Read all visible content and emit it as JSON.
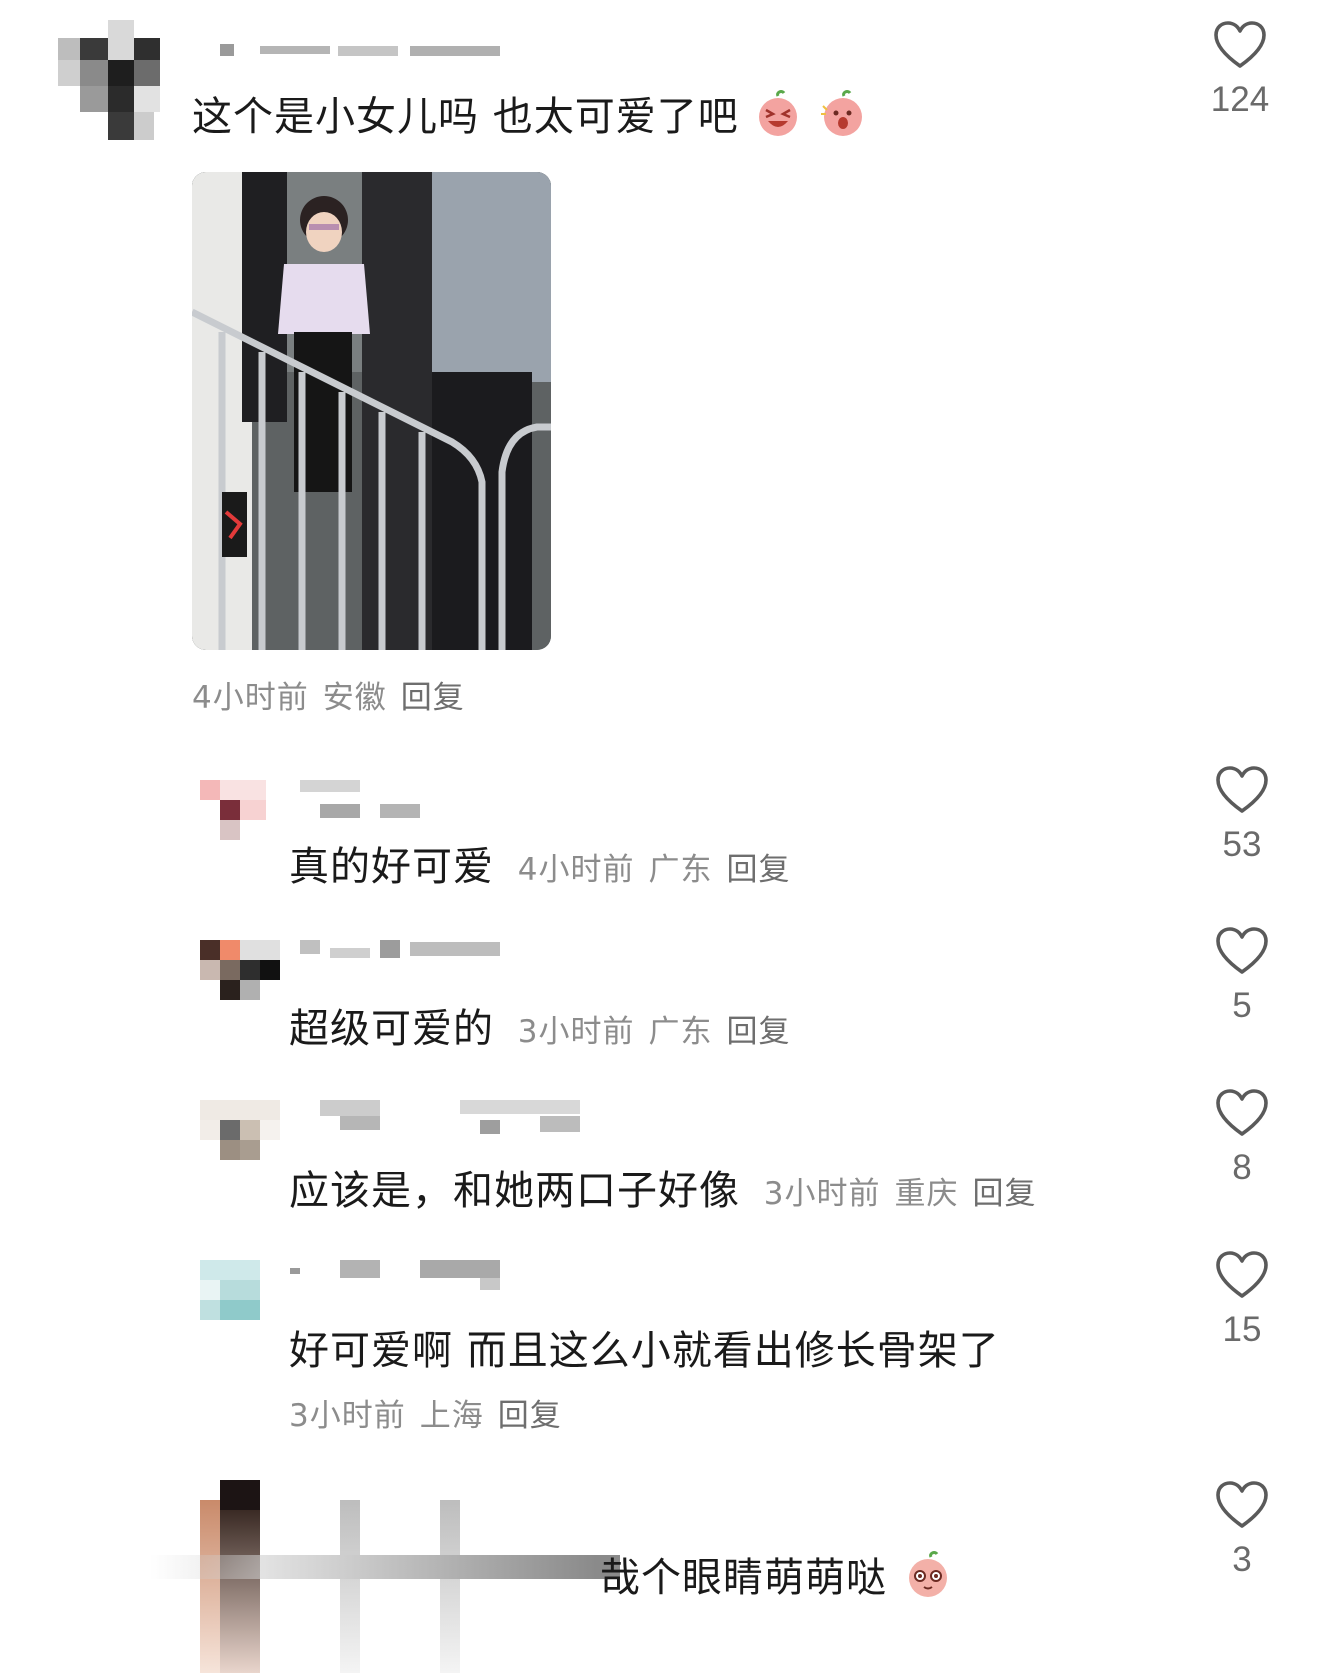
{
  "comments": [
    {
      "avatar": "pixelated-avatar",
      "text": "这个是小女儿吗  也太可爱了吧",
      "emojis": [
        "laughing-peach-emoji",
        "shocked-peach-emoji"
      ],
      "time": "4小时前",
      "location": "安徽",
      "reply_label": "回复",
      "likes": "124",
      "photo": "girl-at-railing-photo"
    }
  ],
  "replies": [
    {
      "text": "真的好可爱",
      "time": "4小时前",
      "location": "广东",
      "reply_label": "回复",
      "likes": "53"
    },
    {
      "text": "超级可爱的",
      "time": "3小时前",
      "location": "广东",
      "reply_label": "回复",
      "likes": "5"
    },
    {
      "text": "应该是，和她两口子好像",
      "time": "3小时前",
      "location": "重庆",
      "reply_label": "回复",
      "likes": "8"
    },
    {
      "text": "好可爱啊 而且这么小就看出修长骨架了",
      "time": "3小时前",
      "location": "上海",
      "reply_label": "回复",
      "likes": "15"
    },
    {
      "text": "哉个眼睛萌萌哒",
      "emoji": "big-eyes-peach-emoji",
      "likes": "3"
    }
  ],
  "icons": {
    "like": "heart-outline-icon"
  },
  "colors": {
    "meta": "#8c8c8c",
    "text": "#1a1a1a",
    "icon": "#5a5a5a"
  }
}
